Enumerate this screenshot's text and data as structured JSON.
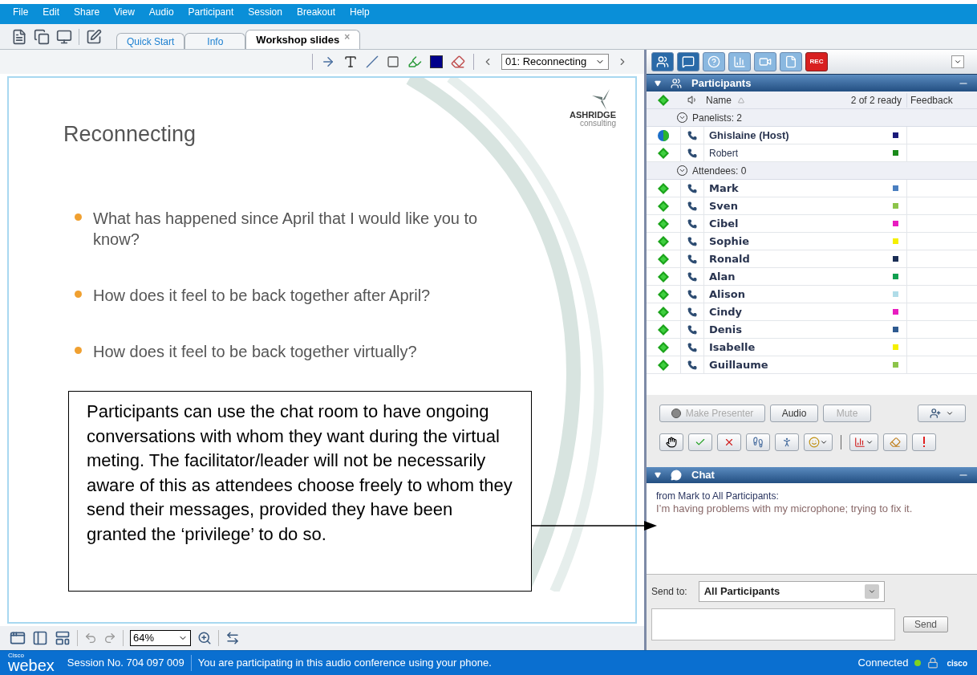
{
  "menu": [
    "File",
    "Edit",
    "Share",
    "View",
    "Audio",
    "Participant",
    "Session",
    "Breakout",
    "Help"
  ],
  "tabs": [
    {
      "label": "Quick Start",
      "selected": false,
      "closable": false
    },
    {
      "label": "Info",
      "selected": false,
      "closable": false
    },
    {
      "label": "Workshop slides",
      "selected": true,
      "closable": true
    }
  ],
  "close_mark": "×",
  "page_select": {
    "value": "01: Reconnecting"
  },
  "slide": {
    "logo": {
      "name": "ASHRIDGE",
      "sub": "consulting"
    },
    "title": "Reconnecting",
    "bullets": [
      "What has happened since April that I would like you to know?",
      "How does it feel to be back together after April?",
      "How does it feel to be back together virtually?"
    ]
  },
  "callout": {
    "text": "Participants can use the chat room to have ongoing conversations with whom they want during the virtual meting. The facilitator/leader will not be necessarily aware of this as attendees choose freely to whom they send their messages, provided they have been granted the ‘privilege’ to do so."
  },
  "zoom": {
    "value": "64%"
  },
  "panel_tools": {
    "rec_label": "REC"
  },
  "participants": {
    "title": "Participants",
    "columns": {
      "name": "Name",
      "ready": "2 of 2 ready",
      "feedback": "Feedback"
    },
    "groups": [
      {
        "label": "Panelists: 2",
        "expanded": true,
        "members": [
          {
            "name": "Ghislaine (Host)",
            "kind": "host",
            "color": "#1a1a7a"
          },
          {
            "name": "Robert",
            "kind": "panelist",
            "color": "#1a8a1a"
          }
        ]
      },
      {
        "label": "Attendees: 0",
        "expanded": true,
        "members": [
          {
            "name": "Mark",
            "kind": "attendee",
            "color": "#4a7fc0"
          },
          {
            "name": "Sven",
            "kind": "attendee",
            "color": "#8cc44a"
          },
          {
            "name": "Cibel",
            "kind": "attendee",
            "color": "#e81cc0"
          },
          {
            "name": "Sophie",
            "kind": "attendee",
            "color": "#f5f000"
          },
          {
            "name": "Ronald",
            "kind": "attendee",
            "color": "#1a2e55"
          },
          {
            "name": "Alan",
            "kind": "attendee",
            "color": "#10a050"
          },
          {
            "name": "Alison",
            "kind": "attendee",
            "color": "#b0dce8"
          },
          {
            "name": "Cindy",
            "kind": "attendee",
            "color": "#e81cc0"
          },
          {
            "name": "Denis",
            "kind": "attendee",
            "color": "#2e5a90"
          },
          {
            "name": "Isabelle",
            "kind": "attendee",
            "color": "#f5f000"
          },
          {
            "name": "Guillaume",
            "kind": "attendee",
            "color": "#8cc44a"
          }
        ]
      }
    ],
    "buttons": [
      {
        "label": "Make Presenter",
        "disabled": true
      },
      {
        "label": "Audio",
        "disabled": false
      },
      {
        "label": "Mute",
        "disabled": true
      }
    ]
  },
  "chat": {
    "title": "Chat",
    "messages": [
      {
        "from": "from Mark to All Participants:",
        "text": "I’m having problems with my microphone; trying to fix it."
      }
    ],
    "send_to_label": "Send to:",
    "send_to": "All Participants",
    "send_button": "Send"
  },
  "status": {
    "brand_small": "Cisco",
    "brand": "webex",
    "session": "Session No. 704 097 009",
    "message": "You are participating in this audio conference using your phone.",
    "connection": "Connected",
    "vendor": "cisco"
  }
}
